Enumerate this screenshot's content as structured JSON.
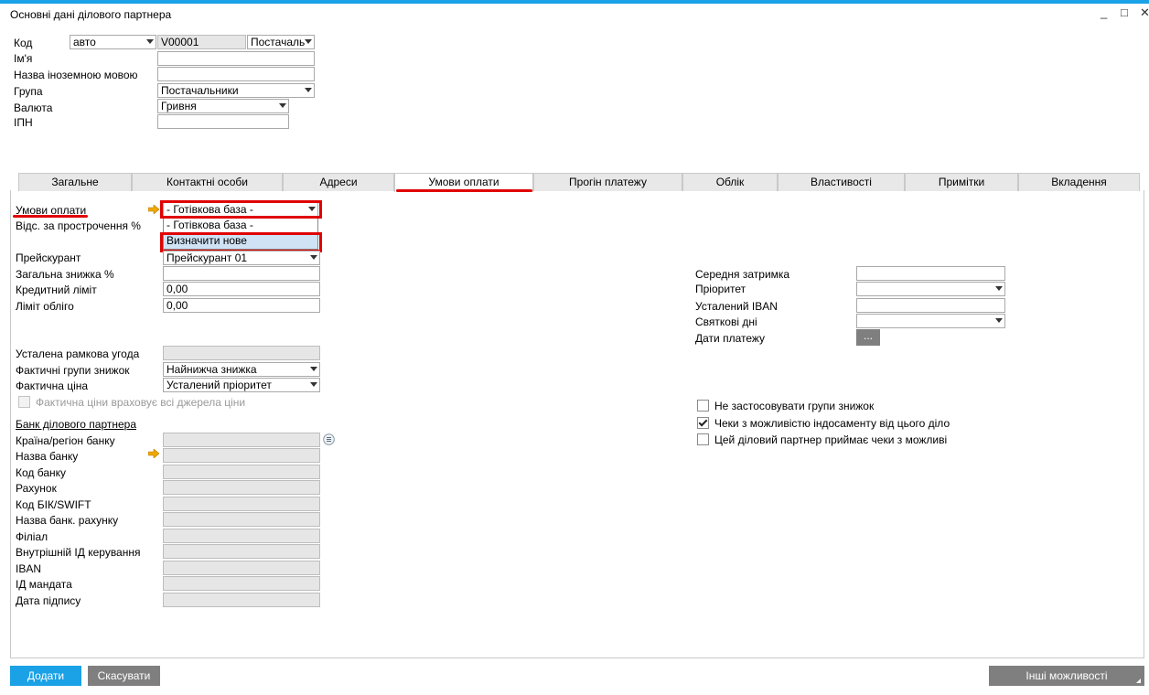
{
  "window": {
    "title": "Основні дані ділового партнера",
    "minimize": "_",
    "maximize": "□",
    "close": "✕"
  },
  "header": {
    "code_label": "Код",
    "code_series": "авто",
    "code_value": "V00001",
    "code_type": "Постачаль",
    "name_label": "Ім'я",
    "name_value": "",
    "foreign_name_label": "Назва іноземною мовою",
    "foreign_name_value": "",
    "group_label": "Група",
    "group_value": "Постачальники",
    "currency_label": "Валюта",
    "currency_value": "Гривня",
    "tax_id_label": "ІПН",
    "tax_id_value": ""
  },
  "tabs": [
    {
      "label": "Загальне"
    },
    {
      "label": "Контактні особи"
    },
    {
      "label": "Адреси"
    },
    {
      "label": "Умови оплати"
    },
    {
      "label": "Прогін платежу"
    },
    {
      "label": "Облік"
    },
    {
      "label": "Властивості"
    },
    {
      "label": "Примітки"
    },
    {
      "label": "Вкладення"
    }
  ],
  "active_tab": "Умови оплати",
  "payment": {
    "payment_terms_label": "Умови оплати",
    "payment_terms_value": "- Готівкова база -",
    "dropdown_options": [
      "- Готівкова база -",
      "Визначити нове"
    ],
    "interest_label": "Відс. за прострочення %",
    "price_list_label": "Прейскурант",
    "price_list_value": "Прейскурант 01",
    "total_discount_label": "Загальна знижка %",
    "total_discount_value": "",
    "credit_limit_label": "Кредитний ліміт",
    "credit_limit_value": "0,00",
    "commitment_limit_label": "Ліміт обліго",
    "commitment_limit_value": "0,00",
    "framework_label": "Усталена рамкова угода",
    "framework_value": "",
    "discount_groups_label": "Фактичні групи знижок",
    "discount_groups_value": "Найнижча знижка",
    "effective_price_label": "Фактична ціна",
    "effective_price_value": "Усталений пріоритет",
    "price_checkbox_label": "Фактична ціни враховує всі джерела ціни"
  },
  "right": {
    "avg_delay_label": "Середня затримка",
    "avg_delay_value": "",
    "priority_label": "Пріоритет",
    "priority_value": "",
    "default_iban_label": "Усталений IBAN",
    "default_iban_value": "",
    "holidays_label": "Святкові дні",
    "holidays_value": "",
    "payment_dates_label": "Дати платежу",
    "payment_dates_button": "...",
    "check1_label": "Не застосовувати групи знижок",
    "check1_checked": false,
    "check2_label": "Чеки з можливістю індосаменту від цього діло",
    "check2_checked": true,
    "check3_label": "Цей діловий партнер приймає чеки з можливі",
    "check3_checked": false
  },
  "bank": {
    "section_title": "Банк ділового партнера",
    "fields": [
      {
        "label": "Країна/регіон банку"
      },
      {
        "label": "Назва банку"
      },
      {
        "label": "Код банку"
      },
      {
        "label": "Рахунок"
      },
      {
        "label": "Код БІК/SWIFT"
      },
      {
        "label": "Назва банк. рахунку"
      },
      {
        "label": "Філіал"
      },
      {
        "label": "Внутрішній ІД керування"
      },
      {
        "label": "IBAN"
      },
      {
        "label": "ІД мандата"
      },
      {
        "label": "Дата підпису"
      }
    ]
  },
  "footer": {
    "add_button": "Додати",
    "cancel_button": "Скасувати",
    "more_button": "Інші можливості"
  },
  "colors": {
    "accent": "#1aa1e6",
    "highlight": "#e00000",
    "secondary_button": "#7f7f7f"
  }
}
